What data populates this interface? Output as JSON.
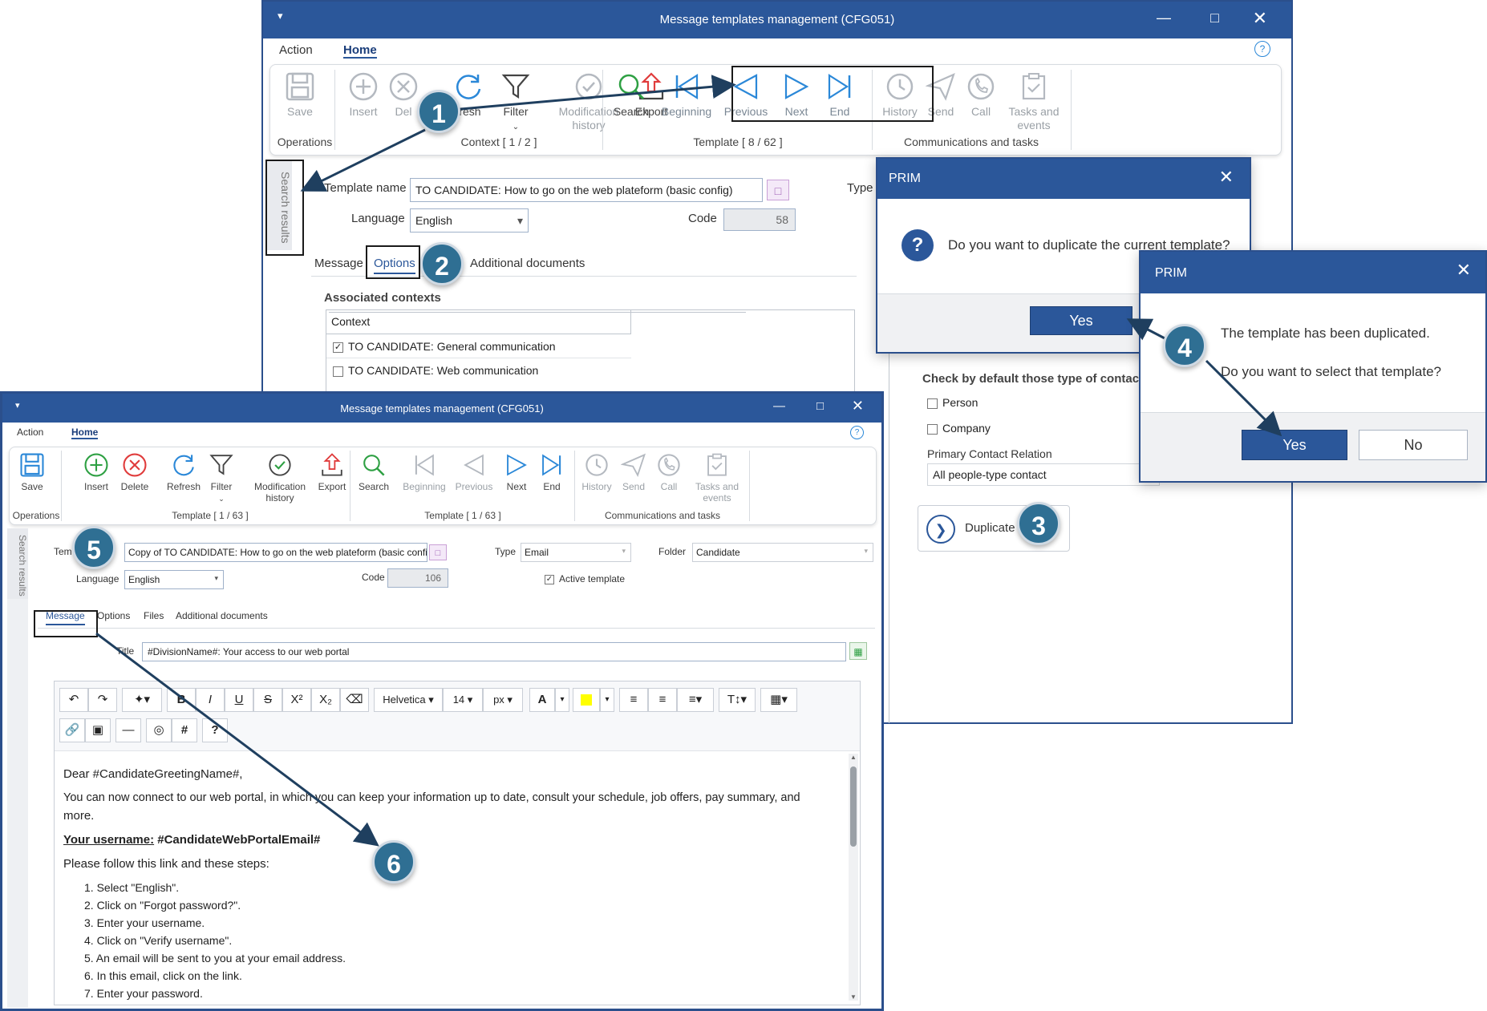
{
  "back_window": {
    "title": "Message templates management (CFG051)",
    "menu": [
      "Action",
      "Home"
    ],
    "ribbon": {
      "buttons": [
        "Save",
        "Insert",
        "Del",
        "fresh",
        "Filter",
        "Modification history",
        "Export",
        "Search",
        "Beginning",
        "Previous",
        "Next",
        "End",
        "History",
        "Send",
        "Call",
        "Tasks and events"
      ],
      "groups": [
        "Operations",
        "Context [ 1 / 2 ]",
        "Template [ 8 / 62 ]",
        "Communications and tasks"
      ]
    },
    "side_label": "Search results",
    "form": {
      "template_name_label": "Template name",
      "template_name_value": "TO CANDIDATE: How to go on the web plateform (basic config)",
      "type_label": "Type",
      "language_label": "Language",
      "language_value": "English",
      "code_label": "Code",
      "code_value": "58"
    },
    "tabs": [
      "Message",
      "Options",
      "Additional documents"
    ],
    "associated_contexts": {
      "heading": "Associated contexts",
      "column": "Context",
      "rows": [
        {
          "label": "TO CANDIDATE: General communication",
          "checked": true
        },
        {
          "label": "TO CANDIDATE: Web communication",
          "checked": false
        }
      ]
    },
    "contacts": {
      "heading": "Check by default those type of contacts:",
      "person": "Person",
      "company": "Company",
      "relation_label": "Primary Contact Relation",
      "relation_value": "All people-type contact"
    },
    "duplicate_button": "Duplicate"
  },
  "dialog1": {
    "title": "PRIM",
    "message": "Do you want to duplicate the current template?",
    "yes": "Yes"
  },
  "dialog2": {
    "title": "PRIM",
    "line1": "The template has been duplicated.",
    "line2": "Do you want to select that template?",
    "yes": "Yes",
    "no": "No"
  },
  "front_window": {
    "title": "Message templates management (CFG051)",
    "menu": [
      "Action",
      "Home"
    ],
    "ribbon": {
      "buttons": [
        "Save",
        "Insert",
        "Delete",
        "Refresh",
        "Filter",
        "Modification history",
        "Export",
        "Search",
        "Beginning",
        "Previous",
        "Next",
        "End",
        "History",
        "Send",
        "Call",
        "Tasks and events"
      ],
      "groups": [
        "Operations",
        "Template [ 1 / 63 ]",
        "Template [ 1 / 63 ]",
        "Communications and tasks"
      ]
    },
    "side_label": "Search results",
    "form": {
      "template_label": "Tem",
      "template_value": "Copy of TO CANDIDATE: How to go on the web plateform (basic config)",
      "type_label": "Type",
      "type_value": "Email",
      "folder_label": "Folder",
      "folder_value": "Candidate",
      "language_label": "Language",
      "language_value": "English",
      "code_label": "Code",
      "code_value": "106",
      "active_label": "Active template"
    },
    "tabs": [
      "Message",
      "Options",
      "Files",
      "Additional documents"
    ],
    "title_label": "Title",
    "title_value": "#DivisionName#: Your access to our web portal",
    "toolbar": {
      "font": "Helvetica",
      "size": "14",
      "unit": "px"
    },
    "editor": {
      "greeting": "Dear #CandidateGreetingName#,",
      "para1": "You can now connect to our web portal, in which you can keep your information up to date, consult your schedule, job offers, pay summary, and",
      "para1b": "more.",
      "username": "Your username:",
      "username_value": " #CandidateWebPortalEmail#",
      "steps_intro": "Please follow this link and these steps:",
      "steps": [
        "1. Select \"English\".",
        "2. Click on \"Forgot password?\".",
        "3. Enter your username.",
        "4. Click on \"Verify username\".",
        "5. An email will be sent to you at your email address.",
        "6. In this email, click on the link.",
        "7. Enter your password."
      ]
    }
  },
  "callouts": [
    "1",
    "2",
    "3",
    "4",
    "5",
    "6"
  ],
  "colors": {
    "titlebar": "#2b579a",
    "callout": "#2f6f93",
    "icon_green": "#2ea043",
    "icon_red": "#e03c3c",
    "icon_blue": "#2b88d8"
  }
}
